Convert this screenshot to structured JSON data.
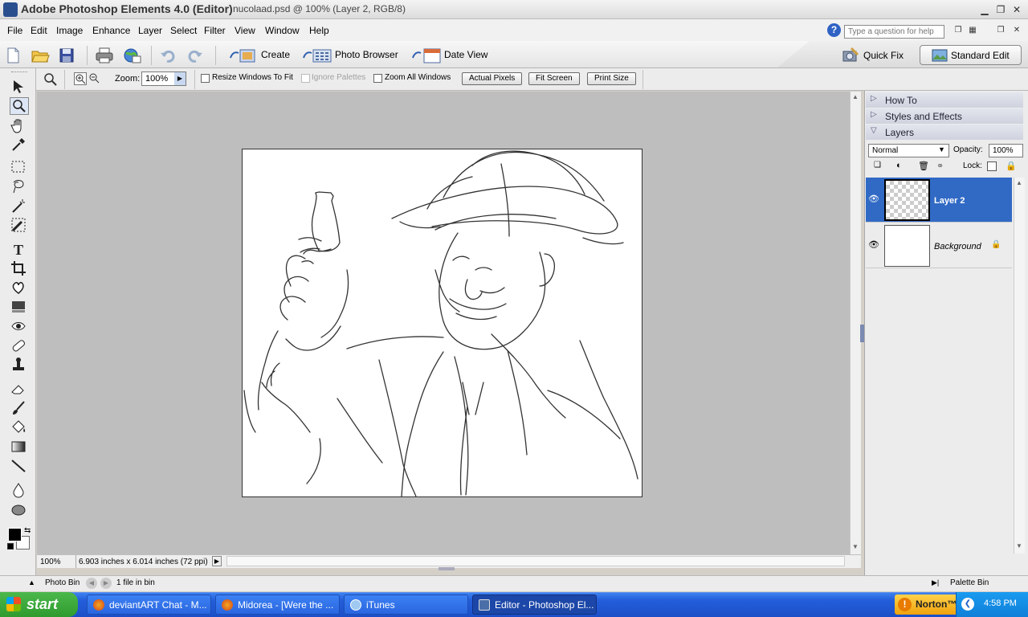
{
  "window": {
    "app_title": "Adobe Photoshop Elements 4.0 (Editor)",
    "doc_title": "nucolaad.psd @ 100% (Layer 2, RGB/8)"
  },
  "menu": [
    "File",
    "Edit",
    "Image",
    "Enhance",
    "Layer",
    "Select",
    "Filter",
    "View",
    "Window",
    "Help"
  ],
  "help_search": {
    "placeholder": "Type a question for help"
  },
  "shortcuts": {
    "create": "Create",
    "photo_browser": "Photo Browser",
    "date_view": "Date View",
    "quick_fix": "Quick Fix",
    "standard_edit": "Standard Edit"
  },
  "options": {
    "zoom_label": "Zoom:",
    "zoom_value": "100%",
    "resize_windows": "Resize Windows To Fit",
    "ignore_palettes": "Ignore Palettes",
    "zoom_all": "Zoom All Windows",
    "actual_pixels": "Actual Pixels",
    "fit_screen": "Fit Screen",
    "print_size": "Print Size"
  },
  "status": {
    "zoom": "100%",
    "doc_size": "6.903 inches x 6.014 inches (72 ppi)"
  },
  "palette": {
    "how_to": "How To",
    "styles": "Styles and Effects",
    "layers": "Layers",
    "blend_mode": "Normal",
    "opacity_label": "Opacity:",
    "opacity_value": "100%",
    "lock_label": "Lock:",
    "layers_list": [
      {
        "name": "Layer 2",
        "selected": true
      },
      {
        "name": "Background",
        "selected": false
      }
    ]
  },
  "photo_bin": {
    "label": "Photo Bin",
    "count": "1 file in bin",
    "palette_bin": "Palette Bin"
  },
  "taskbar": {
    "start": "start",
    "tasks": [
      "deviantART Chat - M...",
      "Midorea - [Were the ...",
      "iTunes",
      "Editor - Photoshop El..."
    ],
    "norton": "Norton™",
    "clock": "4:58 PM"
  },
  "colors": {
    "selected_layer": "#316ac5",
    "taskbar": "#245edb",
    "start_button": "#3a9d3a"
  }
}
